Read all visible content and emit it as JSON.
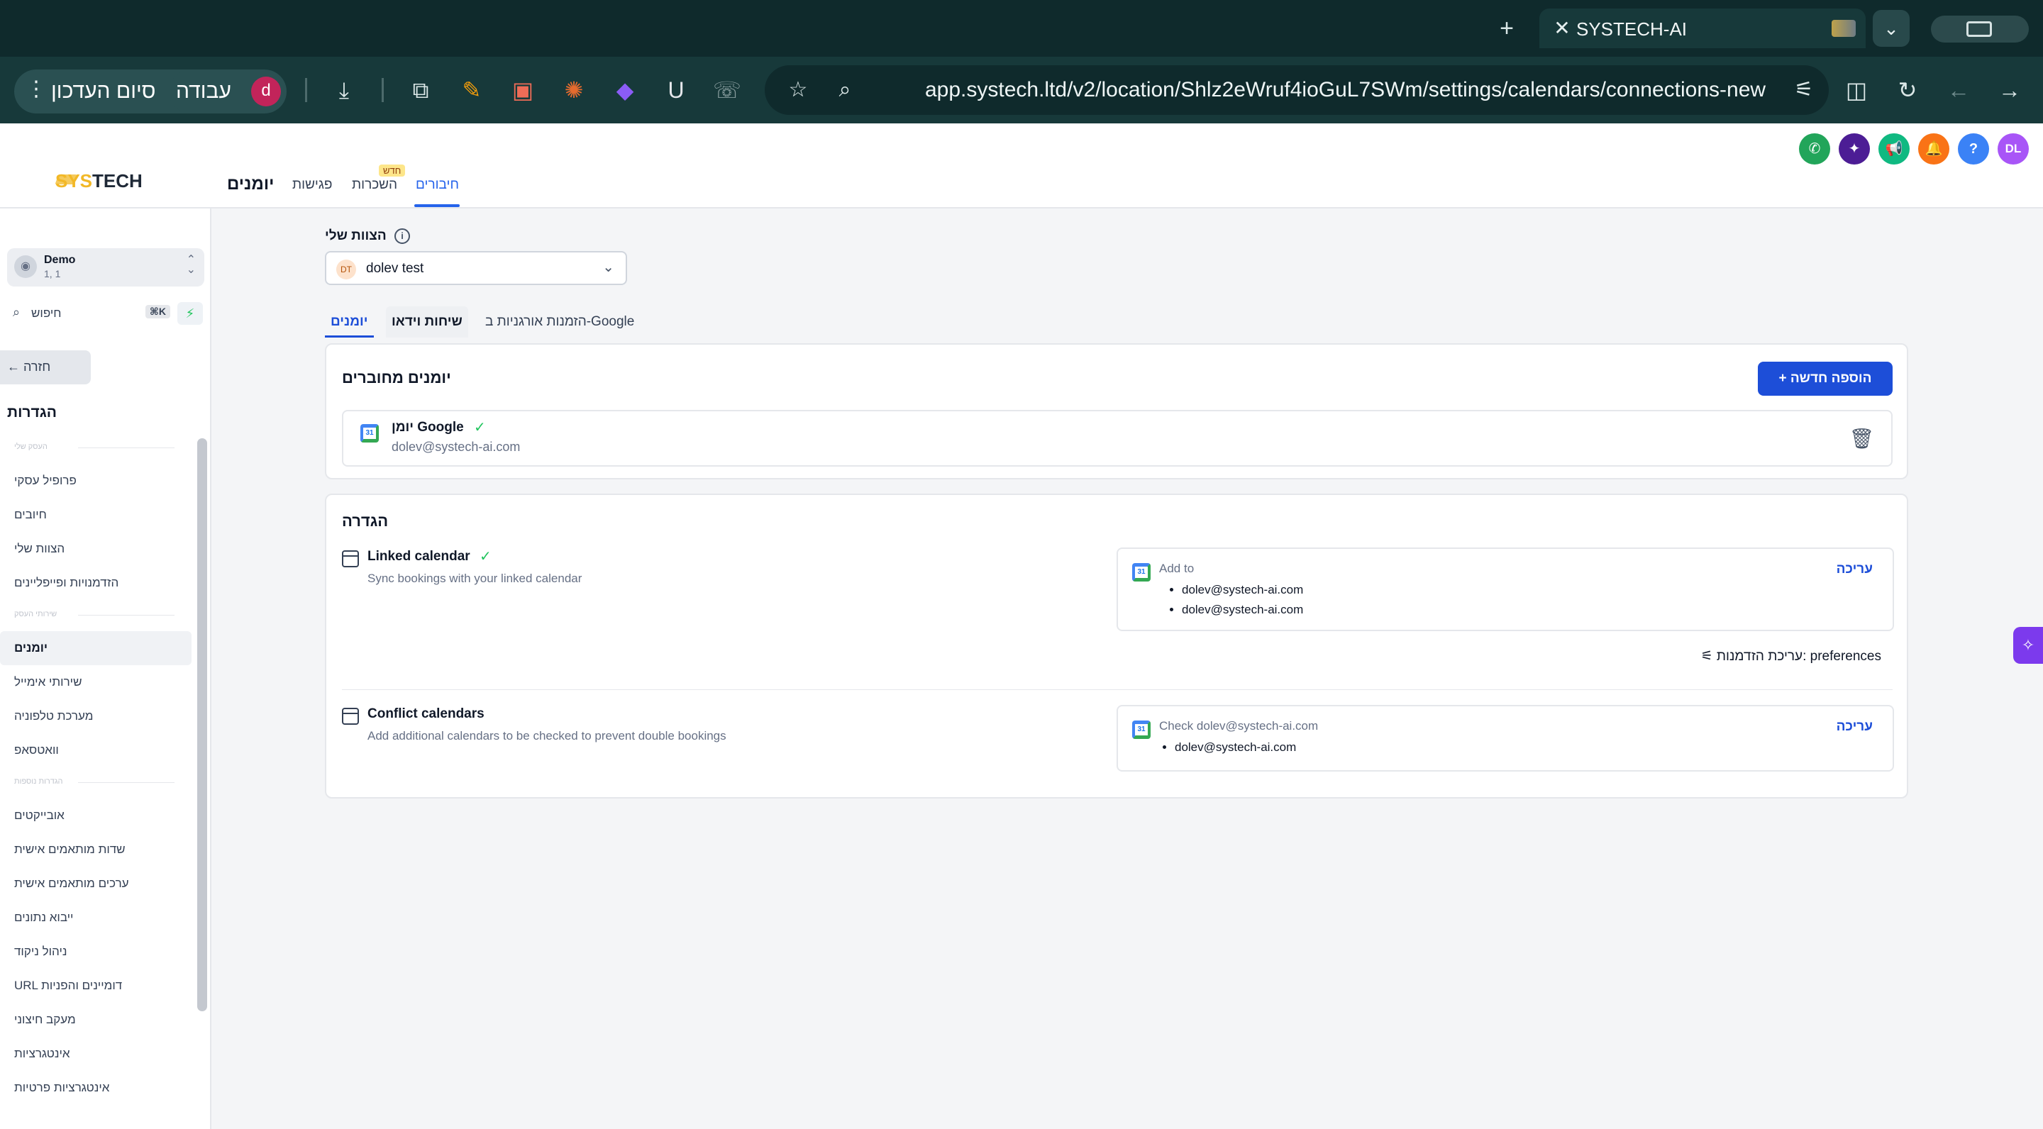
{
  "browser": {
    "tab_title": "SYSTECH-AI",
    "url": "app.systech.ltd/v2/location/Shlz2eWruf4ioGuL7SWm/settings/calendars/connections-new",
    "update_label": "סיום העדכון",
    "profile_label": "עבודה",
    "profile_initial": "d"
  },
  "header": {
    "logo_sys": "SYS",
    "logo_tech": "TECH",
    "page_title": "יומנים",
    "tabs": [
      {
        "label": "חיבורים"
      },
      {
        "label": "השכרות"
      },
      {
        "label": "פגישות"
      }
    ],
    "new_badge": "חדש",
    "avatar_initials": "DL",
    "help_label": "?"
  },
  "sidebar": {
    "account_name": "Demo",
    "account_sub": "1, 1",
    "search_placeholder": "חיפוש",
    "search_shortcut": "⌘K",
    "back_label": "חזרה",
    "heading": "הגדרות",
    "group_1": "העסק שלי",
    "group_2": "שירותי העסק",
    "group_3": "הגדרות נוספות",
    "items_1": [
      {
        "label": "פרופיל עסקי"
      },
      {
        "label": "חיובים"
      },
      {
        "label": "הצוות שלי"
      },
      {
        "label": "הזדמנויות ופייפליינים"
      }
    ],
    "items_2": [
      {
        "label": "יומנים"
      },
      {
        "label": "שירותי אימייל"
      },
      {
        "label": "מערכת טלפוניה"
      },
      {
        "label": "וואטסאפ"
      }
    ],
    "items_3": [
      {
        "label": "אובייקטים"
      },
      {
        "label": "שדות מותאמים אישית"
      },
      {
        "label": "ערכים מותאמים אישית"
      },
      {
        "label": "ייבוא נתונים"
      },
      {
        "label": "ניהול ניקוד"
      },
      {
        "label": "URL דומיינים והפניות"
      },
      {
        "label": "מעקב חיצוני"
      },
      {
        "label": "אינטגרציות"
      },
      {
        "label": "אינטגרציות פרטיות"
      }
    ]
  },
  "main": {
    "team_label": "הצוות שלי",
    "team_value": "dolev test",
    "team_initials": "DT",
    "subtabs": [
      {
        "label": "יומנים"
      },
      {
        "label": "שיחות וידאו"
      },
      {
        "label": "הזמנות אורגניות ב-Google"
      }
    ],
    "connected": {
      "title": "יומנים מחוברים",
      "add_button": "הוספה חדשה",
      "calendar_name": "יומן Google",
      "calendar_email": "dolev@systech-ai.com"
    },
    "config": {
      "title": "הגדרה",
      "linked_title": "Linked calendar",
      "linked_desc": "Sync bookings with your linked calendar",
      "add_to_label": "Add to",
      "add_to_emails": [
        "dolev@systech-ai.com",
        "dolev@systech-ai.com"
      ],
      "edit_label": "עריכה",
      "preferences_label": "עריכת הזדמנות: preferences",
      "conflict_title": "Conflict calendars",
      "conflict_desc": "Add additional calendars to be checked to prevent double bookings",
      "check_label": "Check dolev@systech-ai.com",
      "check_emails": [
        "dolev@systech-ai.com"
      ]
    }
  },
  "colors": {
    "accent": "#1d4ed8",
    "brand": "#f2b827",
    "success": "#22c55e",
    "chrome": "#17393a"
  }
}
